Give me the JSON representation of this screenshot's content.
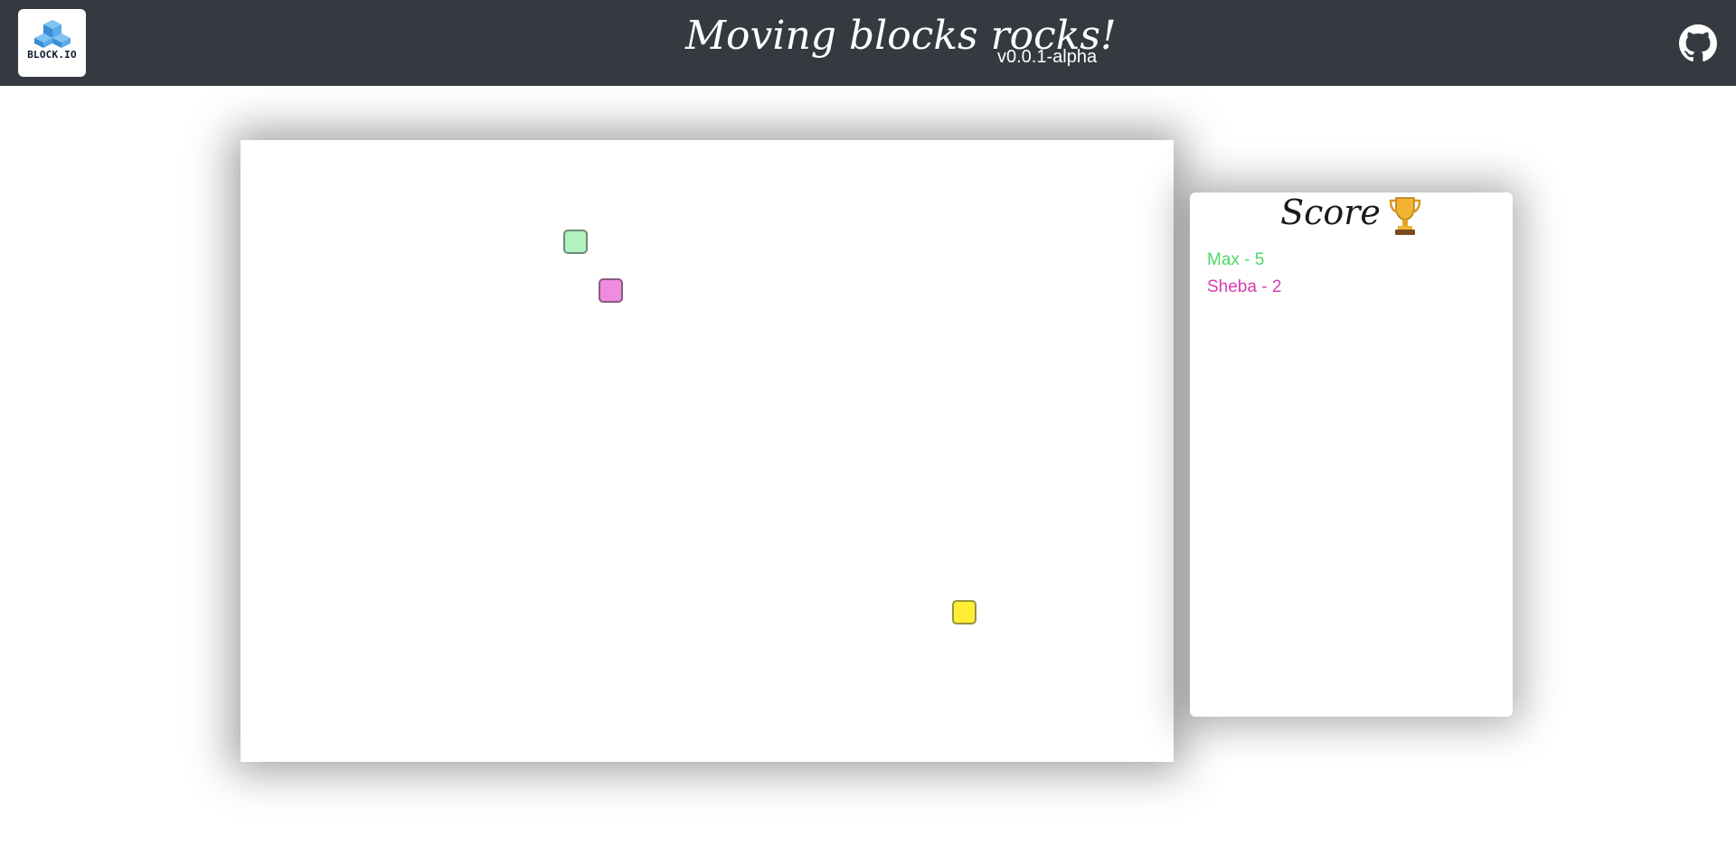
{
  "header": {
    "logo": {
      "text": "BLOCK.IO",
      "icon": "cube-logo-icon"
    },
    "title": "Moving blocks rocks!",
    "version": "v0.0.1-alpha",
    "github_icon": "github-icon",
    "background_color": "#343a40"
  },
  "board": {
    "blocks": [
      {
        "id": "green",
        "fill": "#b2f2c1",
        "border": "#6e8c75"
      },
      {
        "id": "pink",
        "fill": "#ee8ce0",
        "border": "#8a5a80"
      },
      {
        "id": "yellow",
        "fill": "#ffee33",
        "border": "#9a9240"
      }
    ]
  },
  "score": {
    "title": "Score",
    "icon": "trophy-icon",
    "entries": [
      {
        "text": "Max - 5",
        "color": "#4cd964"
      },
      {
        "text": "Sheba - 2",
        "color": "#d63cb5"
      }
    ]
  }
}
